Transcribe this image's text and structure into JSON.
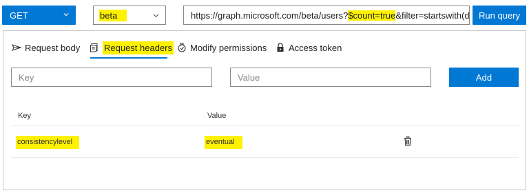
{
  "toolbar": {
    "method": "GET",
    "version": "beta",
    "url_parts": {
      "before": "https://graph.microsoft.com/beta/users?",
      "highlight": "$count=true",
      "after": "&filter=startswith(d..."
    },
    "run_label": "Run query"
  },
  "tabs": [
    {
      "label": "Request body",
      "icon": "send-icon"
    },
    {
      "label": "Request headers",
      "icon": "headers-icon",
      "active": true
    },
    {
      "label": "Modify permissions",
      "icon": "permissions-icon"
    },
    {
      "label": "Access token",
      "icon": "lock-icon"
    }
  ],
  "inputs": {
    "key_placeholder": "Key",
    "value_placeholder": "Value",
    "add_label": "Add"
  },
  "table": {
    "columns": [
      "Key",
      "Value"
    ],
    "rows": [
      {
        "key": "consistencylevel",
        "value": "eventual"
      }
    ]
  },
  "colors": {
    "accent": "#0078d4",
    "highlight": "#fff200"
  }
}
